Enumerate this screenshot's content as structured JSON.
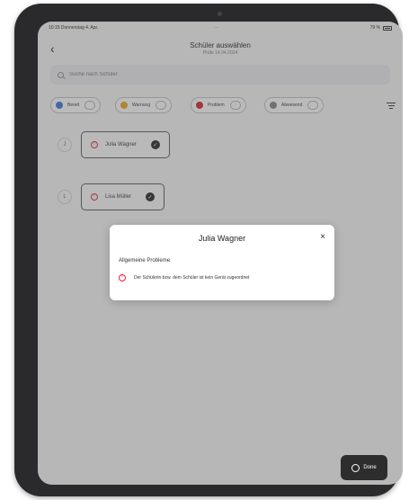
{
  "status_bar": {
    "time_date": "10:15  Donnerstag 4. Apr.",
    "center": "···",
    "right": "79 %"
  },
  "header": {
    "back_icon": "‹",
    "title": "Schüler auswählen",
    "subtitle": "Prüfe 14.04.2024"
  },
  "search": {
    "placeholder": "Suche nach Schüler"
  },
  "filters": [
    {
      "label": "Bereit",
      "color": "#3b6fd6"
    },
    {
      "label": "Warnung",
      "color": "#e0a020"
    },
    {
      "label": "Problem",
      "color": "#d02030"
    },
    {
      "label": "Abwesend",
      "color": "#808080"
    }
  ],
  "students": [
    {
      "initial": "J",
      "name": "Julia Wagner"
    },
    {
      "initial": "L",
      "name": "Lisa Müller"
    }
  ],
  "done_button": {
    "label": "Done"
  },
  "modal": {
    "title": "Julia Wagner",
    "close_icon": "×",
    "section": "Allgemeine Probleme",
    "issue": "Der Schülerin bzw. dem Schüler ist kein Gerät zugeordnet"
  },
  "icons": {
    "warn": "!",
    "check": "✓"
  }
}
